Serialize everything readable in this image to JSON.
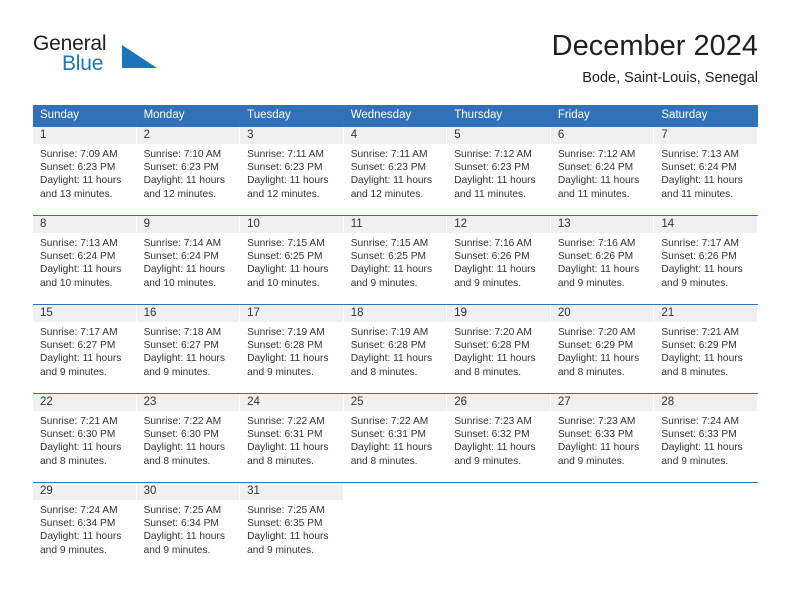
{
  "brand": {
    "name_top": "General",
    "name_bottom": "Blue",
    "accent_color": "#1b75bb",
    "triangle_icon": "triangle-icon"
  },
  "header": {
    "title": "December 2024",
    "subtitle": "Bode, Saint-Louis, Senegal"
  },
  "calendar": {
    "header_bg": "#3071b9",
    "daynum_bg": "#f0f0f0",
    "weekday_headers": [
      "Sunday",
      "Monday",
      "Tuesday",
      "Wednesday",
      "Thursday",
      "Friday",
      "Saturday"
    ],
    "weeks": [
      [
        {
          "day": "1",
          "sunrise": "Sunrise: 7:09 AM",
          "sunset": "Sunset: 6:23 PM",
          "daylight_line1": "Daylight: 11 hours",
          "daylight_line2": "and 13 minutes."
        },
        {
          "day": "2",
          "sunrise": "Sunrise: 7:10 AM",
          "sunset": "Sunset: 6:23 PM",
          "daylight_line1": "Daylight: 11 hours",
          "daylight_line2": "and 12 minutes."
        },
        {
          "day": "3",
          "sunrise": "Sunrise: 7:11 AM",
          "sunset": "Sunset: 6:23 PM",
          "daylight_line1": "Daylight: 11 hours",
          "daylight_line2": "and 12 minutes."
        },
        {
          "day": "4",
          "sunrise": "Sunrise: 7:11 AM",
          "sunset": "Sunset: 6:23 PM",
          "daylight_line1": "Daylight: 11 hours",
          "daylight_line2": "and 12 minutes."
        },
        {
          "day": "5",
          "sunrise": "Sunrise: 7:12 AM",
          "sunset": "Sunset: 6:23 PM",
          "daylight_line1": "Daylight: 11 hours",
          "daylight_line2": "and 11 minutes."
        },
        {
          "day": "6",
          "sunrise": "Sunrise: 7:12 AM",
          "sunset": "Sunset: 6:24 PM",
          "daylight_line1": "Daylight: 11 hours",
          "daylight_line2": "and 11 minutes."
        },
        {
          "day": "7",
          "sunrise": "Sunrise: 7:13 AM",
          "sunset": "Sunset: 6:24 PM",
          "daylight_line1": "Daylight: 11 hours",
          "daylight_line2": "and 11 minutes."
        }
      ],
      [
        {
          "day": "8",
          "sunrise": "Sunrise: 7:13 AM",
          "sunset": "Sunset: 6:24 PM",
          "daylight_line1": "Daylight: 11 hours",
          "daylight_line2": "and 10 minutes."
        },
        {
          "day": "9",
          "sunrise": "Sunrise: 7:14 AM",
          "sunset": "Sunset: 6:24 PM",
          "daylight_line1": "Daylight: 11 hours",
          "daylight_line2": "and 10 minutes."
        },
        {
          "day": "10",
          "sunrise": "Sunrise: 7:15 AM",
          "sunset": "Sunset: 6:25 PM",
          "daylight_line1": "Daylight: 11 hours",
          "daylight_line2": "and 10 minutes."
        },
        {
          "day": "11",
          "sunrise": "Sunrise: 7:15 AM",
          "sunset": "Sunset: 6:25 PM",
          "daylight_line1": "Daylight: 11 hours",
          "daylight_line2": "and 9 minutes."
        },
        {
          "day": "12",
          "sunrise": "Sunrise: 7:16 AM",
          "sunset": "Sunset: 6:26 PM",
          "daylight_line1": "Daylight: 11 hours",
          "daylight_line2": "and 9 minutes."
        },
        {
          "day": "13",
          "sunrise": "Sunrise: 7:16 AM",
          "sunset": "Sunset: 6:26 PM",
          "daylight_line1": "Daylight: 11 hours",
          "daylight_line2": "and 9 minutes."
        },
        {
          "day": "14",
          "sunrise": "Sunrise: 7:17 AM",
          "sunset": "Sunset: 6:26 PM",
          "daylight_line1": "Daylight: 11 hours",
          "daylight_line2": "and 9 minutes."
        }
      ],
      [
        {
          "day": "15",
          "sunrise": "Sunrise: 7:17 AM",
          "sunset": "Sunset: 6:27 PM",
          "daylight_line1": "Daylight: 11 hours",
          "daylight_line2": "and 9 minutes."
        },
        {
          "day": "16",
          "sunrise": "Sunrise: 7:18 AM",
          "sunset": "Sunset: 6:27 PM",
          "daylight_line1": "Daylight: 11 hours",
          "daylight_line2": "and 9 minutes."
        },
        {
          "day": "17",
          "sunrise": "Sunrise: 7:19 AM",
          "sunset": "Sunset: 6:28 PM",
          "daylight_line1": "Daylight: 11 hours",
          "daylight_line2": "and 9 minutes."
        },
        {
          "day": "18",
          "sunrise": "Sunrise: 7:19 AM",
          "sunset": "Sunset: 6:28 PM",
          "daylight_line1": "Daylight: 11 hours",
          "daylight_line2": "and 8 minutes."
        },
        {
          "day": "19",
          "sunrise": "Sunrise: 7:20 AM",
          "sunset": "Sunset: 6:28 PM",
          "daylight_line1": "Daylight: 11 hours",
          "daylight_line2": "and 8 minutes."
        },
        {
          "day": "20",
          "sunrise": "Sunrise: 7:20 AM",
          "sunset": "Sunset: 6:29 PM",
          "daylight_line1": "Daylight: 11 hours",
          "daylight_line2": "and 8 minutes."
        },
        {
          "day": "21",
          "sunrise": "Sunrise: 7:21 AM",
          "sunset": "Sunset: 6:29 PM",
          "daylight_line1": "Daylight: 11 hours",
          "daylight_line2": "and 8 minutes."
        }
      ],
      [
        {
          "day": "22",
          "sunrise": "Sunrise: 7:21 AM",
          "sunset": "Sunset: 6:30 PM",
          "daylight_line1": "Daylight: 11 hours",
          "daylight_line2": "and 8 minutes."
        },
        {
          "day": "23",
          "sunrise": "Sunrise: 7:22 AM",
          "sunset": "Sunset: 6:30 PM",
          "daylight_line1": "Daylight: 11 hours",
          "daylight_line2": "and 8 minutes."
        },
        {
          "day": "24",
          "sunrise": "Sunrise: 7:22 AM",
          "sunset": "Sunset: 6:31 PM",
          "daylight_line1": "Daylight: 11 hours",
          "daylight_line2": "and 8 minutes."
        },
        {
          "day": "25",
          "sunrise": "Sunrise: 7:22 AM",
          "sunset": "Sunset: 6:31 PM",
          "daylight_line1": "Daylight: 11 hours",
          "daylight_line2": "and 8 minutes."
        },
        {
          "day": "26",
          "sunrise": "Sunrise: 7:23 AM",
          "sunset": "Sunset: 6:32 PM",
          "daylight_line1": "Daylight: 11 hours",
          "daylight_line2": "and 9 minutes."
        },
        {
          "day": "27",
          "sunrise": "Sunrise: 7:23 AM",
          "sunset": "Sunset: 6:33 PM",
          "daylight_line1": "Daylight: 11 hours",
          "daylight_line2": "and 9 minutes."
        },
        {
          "day": "28",
          "sunrise": "Sunrise: 7:24 AM",
          "sunset": "Sunset: 6:33 PM",
          "daylight_line1": "Daylight: 11 hours",
          "daylight_line2": "and 9 minutes."
        }
      ],
      [
        {
          "day": "29",
          "sunrise": "Sunrise: 7:24 AM",
          "sunset": "Sunset: 6:34 PM",
          "daylight_line1": "Daylight: 11 hours",
          "daylight_line2": "and 9 minutes."
        },
        {
          "day": "30",
          "sunrise": "Sunrise: 7:25 AM",
          "sunset": "Sunset: 6:34 PM",
          "daylight_line1": "Daylight: 11 hours",
          "daylight_line2": "and 9 minutes."
        },
        {
          "day": "31",
          "sunrise": "Sunrise: 7:25 AM",
          "sunset": "Sunset: 6:35 PM",
          "daylight_line1": "Daylight: 11 hours",
          "daylight_line2": "and 9 minutes."
        },
        {
          "day": "",
          "sunrise": "",
          "sunset": "",
          "daylight_line1": "",
          "daylight_line2": ""
        },
        {
          "day": "",
          "sunrise": "",
          "sunset": "",
          "daylight_line1": "",
          "daylight_line2": ""
        },
        {
          "day": "",
          "sunrise": "",
          "sunset": "",
          "daylight_line1": "",
          "daylight_line2": ""
        },
        {
          "day": "",
          "sunrise": "",
          "sunset": "",
          "daylight_line1": "",
          "daylight_line2": ""
        }
      ]
    ]
  }
}
